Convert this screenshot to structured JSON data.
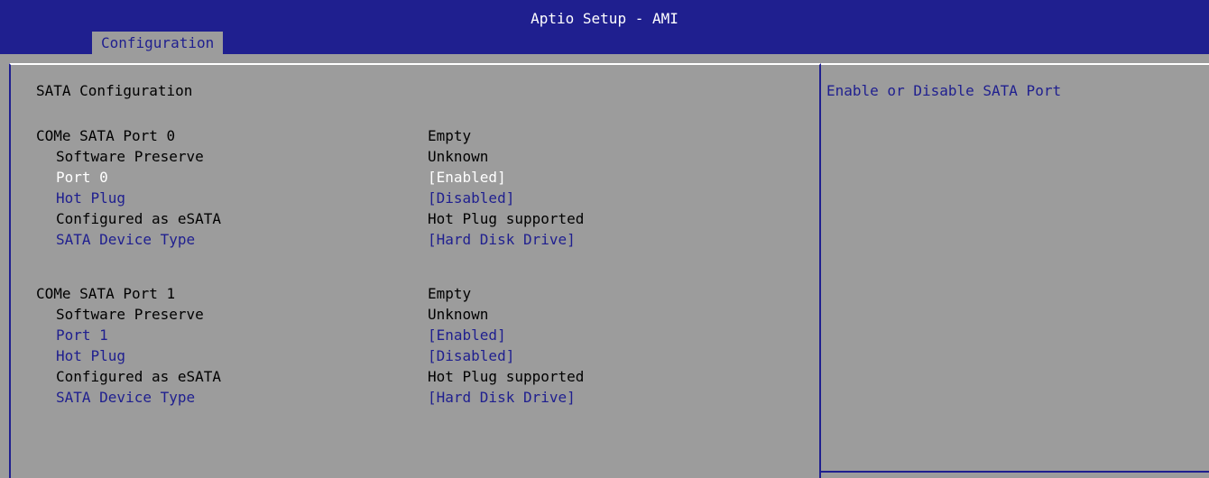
{
  "header": {
    "title": "Aptio Setup - AMI",
    "tab": "Configuration"
  },
  "main": {
    "section_title": "SATA Configuration",
    "port0": {
      "title": "COMe SATA Port 0",
      "title_value": "Empty",
      "software_preserve_label": "Software Preserve",
      "software_preserve_value": "Unknown",
      "port_label": "Port 0",
      "port_value": "[Enabled]",
      "hot_plug_label": "Hot Plug",
      "hot_plug_value": "[Disabled]",
      "configured_label": "Configured as eSATA",
      "configured_value": "Hot Plug supported",
      "device_type_label": "SATA Device Type",
      "device_type_value": "[Hard Disk Drive]"
    },
    "port1": {
      "title": "COMe SATA Port 1",
      "title_value": "Empty",
      "software_preserve_label": "Software Preserve",
      "software_preserve_value": "Unknown",
      "port_label": "Port 1",
      "port_value": "[Enabled]",
      "hot_plug_label": "Hot Plug",
      "hot_plug_value": "[Disabled]",
      "configured_label": "Configured as eSATA",
      "configured_value": "Hot Plug supported",
      "device_type_label": "SATA Device Type",
      "device_type_value": "[Hard Disk Drive]"
    }
  },
  "help": {
    "text": "Enable or Disable SATA Port"
  },
  "colors": {
    "header_bg": "#1f1f8f",
    "panel_bg": "#9c9c9c",
    "selectable_text": "#1f1f8f",
    "highlight_text": "#ffffff"
  }
}
